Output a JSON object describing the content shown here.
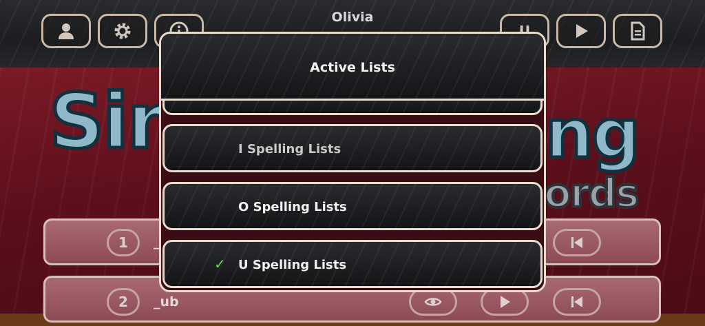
{
  "header": {
    "username": "Olivia",
    "buttons": [
      {
        "name": "profile-button",
        "icon": "person-icon"
      },
      {
        "name": "settings-button",
        "icon": "gear-icon"
      },
      {
        "name": "info-button",
        "icon": "info-icon"
      },
      {
        "name": "list-button",
        "icon": "u-list-icon",
        "label": "U"
      },
      {
        "name": "play-button",
        "icon": "play-icon"
      },
      {
        "name": "document-button",
        "icon": "document-icon"
      }
    ]
  },
  "logo": {
    "line1_left": "Sin",
    "line1_right": "ng",
    "line2": "ords"
  },
  "rows": [
    {
      "number": "1",
      "word": "_"
    },
    {
      "number": "2",
      "word": "_ub"
    }
  ],
  "modal": {
    "title": "Active Lists",
    "items": [
      {
        "label": "I Spelling Lists",
        "checked": false
      },
      {
        "label": "O Spelling Lists",
        "checked": false
      },
      {
        "label": "U Spelling Lists",
        "checked": true
      }
    ],
    "check_glyph": "✓"
  },
  "colors": {
    "check": "#5ee04a",
    "border": "#e8dccf",
    "board": "#5c0f1b"
  }
}
